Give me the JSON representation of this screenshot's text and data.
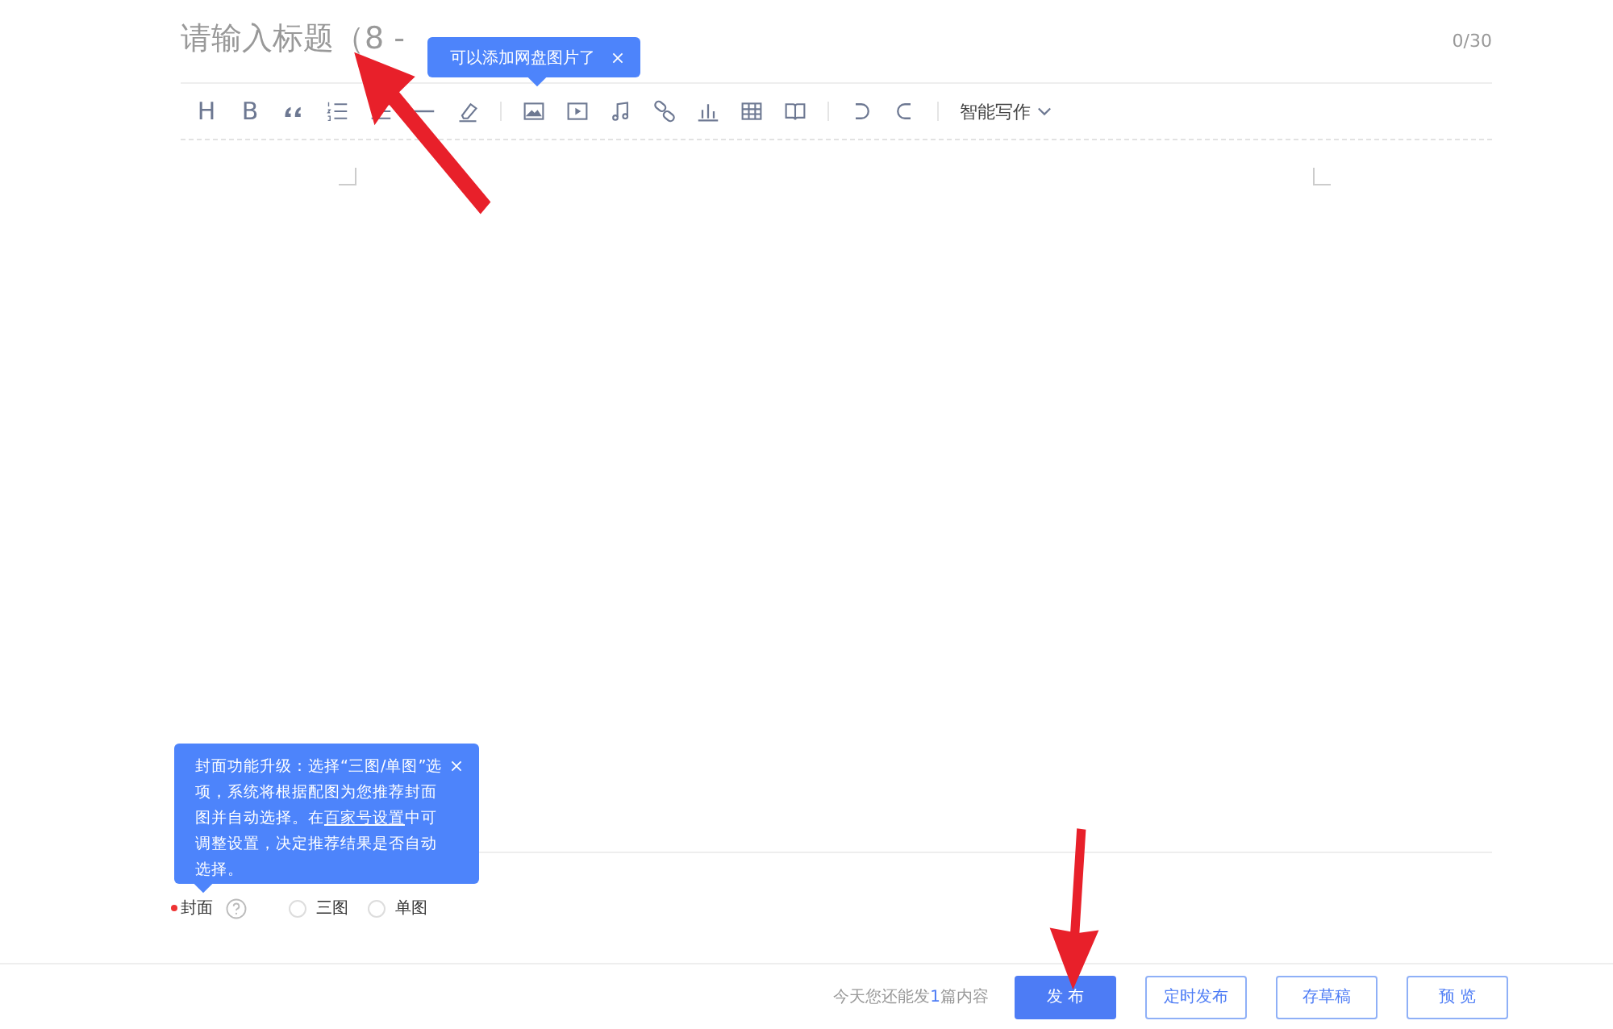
{
  "title": {
    "placeholder": "请输入标题（8 -",
    "counter": "0/30"
  },
  "image_tip": {
    "text": "可以添加网盘图片了"
  },
  "toolbar": {
    "heading": "H",
    "bold": "B",
    "ai_menu": "智能写作"
  },
  "cover_tip": {
    "before": "封面功能升级：选择“三图/单图”选项，系统将根据配图为您推荐封面图并自动选择。在",
    "link": "百家号设置",
    "after": "中可调整设置，决定推荐结果是否自动选择。"
  },
  "cover": {
    "label": "封面",
    "required": true,
    "options": [
      {
        "label": "三图",
        "selected": false
      },
      {
        "label": "单图",
        "selected": false
      }
    ]
  },
  "footer": {
    "quota_before": "今天您还能发",
    "quota_count": "1",
    "quota_after": "篇内容",
    "buttons": [
      {
        "label": "发 布",
        "kind": "primary"
      },
      {
        "label": "定时发布",
        "kind": "outline"
      },
      {
        "label": "存草稿",
        "kind": "outline"
      },
      {
        "label": "预 览",
        "kind": "outline"
      }
    ]
  }
}
